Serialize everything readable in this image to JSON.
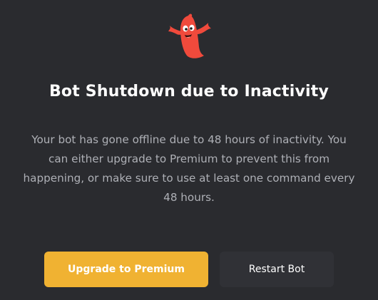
{
  "dialog": {
    "mascot_icon": "red-ghost-mascot-icon",
    "title": "Bot Shutdown due to Inactivity",
    "message": "Your bot has gone offline due to 48 hours of inactivity. You can either upgrade to Premium to prevent this from happening, or make sure to use at least one command every 48 hours.",
    "primary_button": "Upgrade to Premium",
    "secondary_button": "Restart Bot"
  },
  "colors": {
    "background": "#2a2b2f",
    "accent": "#f0b232",
    "mascot": "#f04a3c",
    "secondary_button": "#303136"
  }
}
